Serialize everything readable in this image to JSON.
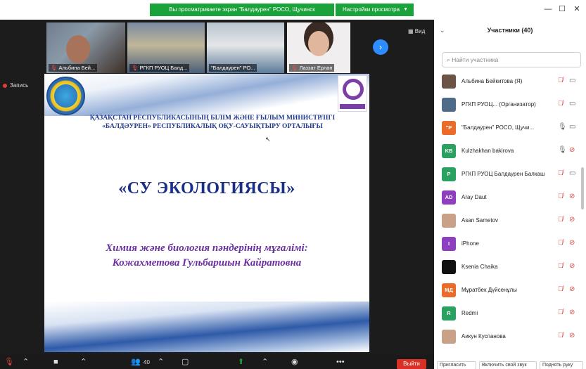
{
  "window": {
    "share_banner": "Вы просматриваете экран \"Балдаурен\" РОСО, Щучинск",
    "view_options": "Настройки просмотра"
  },
  "recording": {
    "label": "Запись"
  },
  "videos": [
    {
      "name": "Альбина Бей..."
    },
    {
      "name": "РГКП РУОЦ Балд..."
    },
    {
      "name": "\"Балдаурен\" РО..."
    },
    {
      "name": "Лаззат Ерлан"
    }
  ],
  "view_button": "Вид",
  "slide": {
    "ministry_line1": "ҚАЗАҚСТАН РЕСПУБЛИКАСЫНЫҢ БІЛІМ ЖӘНЕ ҒЫЛЫМ МИНИСТРЛІГІ",
    "ministry_line2": "«БАЛДӘУРЕН» РЕСПУБЛИКАЛЫҚ ОҚУ-САУЫҚТЫРУ ОРТАЛЫҒЫ",
    "title": "«СУ ЭКОЛОГИЯСЫ»",
    "subtitle_line1": "Химия және биология пәндерінің мұғалімі:",
    "subtitle_line2": "Кожахметова Гульбаршын Кайратовна"
  },
  "toolbar": {
    "participants_count": "40",
    "leave_label": "Выйти"
  },
  "panel": {
    "title": "Участники (40)",
    "search_placeholder": "Найти участника",
    "participants": [
      {
        "name": "Альбина Бейкитова (Я)",
        "avatar_text": "",
        "avatar_color": "#6b5446",
        "mic": "muted",
        "cam": "off"
      },
      {
        "name": "РГКП РУОЦ... (Организатор)",
        "avatar_text": "",
        "avatar_color": "#4e6c8a",
        "mic": "muted",
        "cam": "off"
      },
      {
        "name": "\"Балдаурен\" РОСО, Щучи...",
        "avatar_text": "\"Р",
        "avatar_color": "#ea6b2a",
        "mic": "on",
        "cam": "off"
      },
      {
        "name": "Kulzhakhan bakirova",
        "avatar_text": "KB",
        "avatar_color": "#2aa160",
        "mic": "on",
        "cam": "muted"
      },
      {
        "name": "РГКП РУОЦ Балдаурен Балкаш",
        "avatar_text": "Р",
        "avatar_color": "#2aa160",
        "mic": "muted",
        "cam": "off"
      },
      {
        "name": "Aray Daut",
        "avatar_text": "AD",
        "avatar_color": "#8e3fc0",
        "mic": "muted",
        "cam": "muted"
      },
      {
        "name": "Asan Sametov",
        "avatar_text": "",
        "avatar_color": "#c9a189",
        "mic": "muted",
        "cam": "muted"
      },
      {
        "name": "iPhone",
        "avatar_text": "I",
        "avatar_color": "#8e3fc0",
        "mic": "muted",
        "cam": "muted"
      },
      {
        "name": "Ksenia Chaika",
        "avatar_text": "",
        "avatar_color": "#111111",
        "mic": "muted",
        "cam": "muted"
      },
      {
        "name": "Мұратбек Дүйсенұлы",
        "avatar_text": "МД",
        "avatar_color": "#ea6b2a",
        "mic": "muted",
        "cam": "muted"
      },
      {
        "name": "Redmi",
        "avatar_text": "R",
        "avatar_color": "#2aa160",
        "mic": "muted",
        "cam": "muted"
      },
      {
        "name": "Аикун Куспанова",
        "avatar_text": "",
        "avatar_color": "#c9a189",
        "mic": "muted",
        "cam": "muted"
      }
    ],
    "footer": {
      "invite": "Пригласить",
      "unmute_me": "Включить свой звук",
      "raise_hand": "Поднять руку"
    }
  }
}
